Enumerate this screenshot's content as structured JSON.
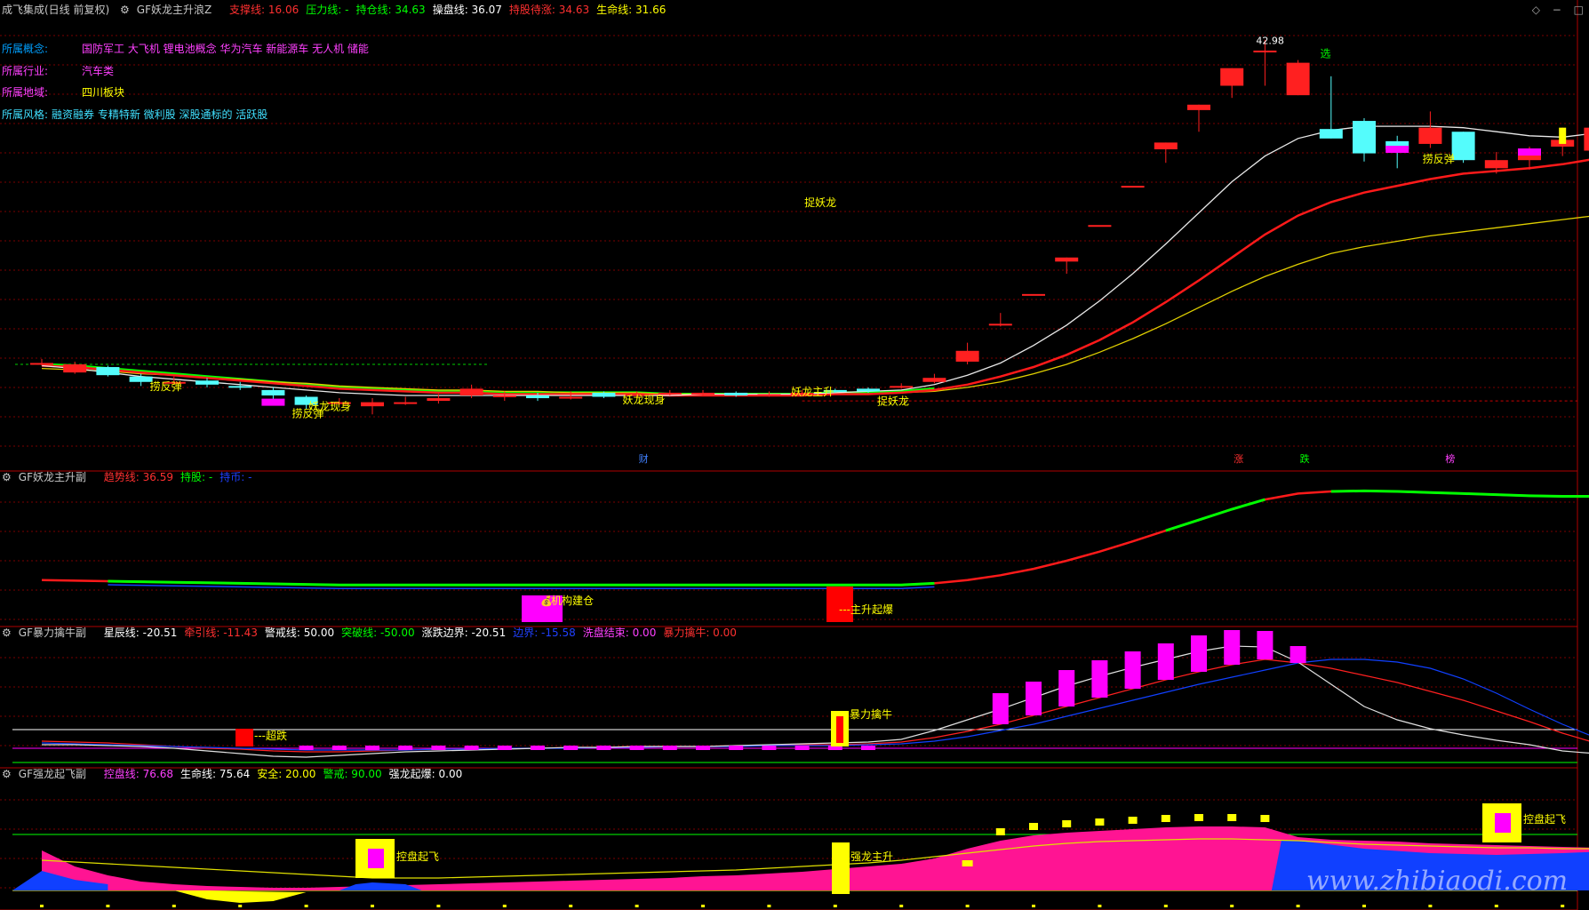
{
  "colors": {
    "bg": "#000000",
    "grid": "#7a0000",
    "red": "#ff2a2a",
    "cyan": "#54fcfc",
    "magenta": "#ff00ff",
    "yellow": "#ffff00",
    "white": "#ffffff",
    "green": "#00ff00",
    "blue": "#1040ff",
    "pink": "#ff1493",
    "text_gray": "#c8c8c8"
  },
  "window_buttons": [
    "◇",
    "−",
    "□"
  ],
  "panel1": {
    "title": "成飞集成(日线 前复权)",
    "indicator": "GF妖龙主升浪Z",
    "fields": [
      {
        "label": "支撑线:",
        "value": "16.06",
        "color": "#ff3030"
      },
      {
        "label": "压力线:",
        "value": "-",
        "color": "#00ff00"
      },
      {
        "label": "持仓线:",
        "value": "34.63",
        "color": "#00ff00"
      },
      {
        "label": "操盘线:",
        "value": "36.07",
        "color": "#ffffff"
      },
      {
        "label": "持股待涨:",
        "value": "34.63",
        "color": "#ff3030"
      },
      {
        "label": "生命线:",
        "value": "31.66",
        "color": "#ffff00"
      }
    ],
    "info": [
      {
        "label": "所属概念:",
        "value": "国防军工 大飞机 锂电池概念 华为汽车 新能源车 无人机 储能",
        "lc": "#00a0ff",
        "vc": "#ff40ff"
      },
      {
        "label": "所属行业:",
        "value": "汽车类",
        "lc": "#ff40ff",
        "vc": "#ff40ff"
      },
      {
        "label": "所属地域:",
        "value": "四川板块",
        "lc": "#ff40ff",
        "vc": "#ffff00"
      },
      {
        "label": "所属风格:",
        "value": "融资融券 专精特新 微利股 深股通标的 活跃股",
        "lc": "#40e0ff",
        "vc": "#40e0ff"
      }
    ],
    "high_label": "42.98",
    "signals": [
      {
        "text": "捞反弹",
        "color": "#ffff00"
      },
      {
        "text": "捞反弹",
        "color": "#ffff00"
      },
      {
        "text": "妖龙现身",
        "color": "#ffff00"
      },
      {
        "text": "妖龙现身",
        "color": "#ffff00"
      },
      {
        "text": "捉妖龙",
        "color": "#ffff00"
      },
      {
        "text": "妖龙主升",
        "color": "#ffff00"
      },
      {
        "text": "捉妖龙",
        "color": "#ffff00"
      },
      {
        "text": "选",
        "color": "#00ff00"
      },
      {
        "text": "捞反弹",
        "color": "#ffff00"
      },
      {
        "text": "捞反弹",
        "color": "#ffff00"
      },
      {
        "text": "妖龙现身",
        "color": "#ffff00"
      }
    ],
    "markers": [
      {
        "text": "财",
        "color": "#4080ff"
      },
      {
        "text": "涨",
        "color": "#ff3030"
      },
      {
        "text": "跌",
        "color": "#00ff00"
      },
      {
        "text": "榜",
        "color": "#ff40ff"
      }
    ]
  },
  "panel2": {
    "indicator": "GF妖龙主升副",
    "fields": [
      {
        "label": "趋势线:",
        "value": "36.59",
        "color": "#ff3030"
      },
      {
        "label": "持股:",
        "value": "-",
        "color": "#00ff00"
      },
      {
        "label": "持币:",
        "value": "-",
        "color": "#2040ff"
      }
    ],
    "signals": [
      {
        "text": "机构建仓",
        "color": "#ffff00"
      },
      {
        "text": "主升起爆",
        "color": "#ffff00"
      }
    ]
  },
  "panel3": {
    "indicator": "GF暴力擒牛副",
    "fields": [
      {
        "label": "星辰线:",
        "value": "-20.51",
        "color": "#ffffff"
      },
      {
        "label": "牵引线:",
        "value": "-11.43",
        "color": "#ff3030"
      },
      {
        "label": "警戒线:",
        "value": "50.00",
        "color": "#ffffff"
      },
      {
        "label": "突破线:",
        "value": "-50.00",
        "color": "#00ff00"
      },
      {
        "label": "涨跌边界:",
        "value": "-20.51",
        "color": "#ffffff"
      },
      {
        "label": "边界:",
        "value": "-15.58",
        "color": "#2040ff"
      },
      {
        "label": "洗盘结束:",
        "value": "0.00",
        "color": "#ff40ff"
      },
      {
        "label": "暴力擒牛:",
        "value": "0.00",
        "color": "#ff3030"
      }
    ],
    "signals": [
      {
        "text": "超跌",
        "color": "#ffff00"
      },
      {
        "text": "暴力擒牛",
        "color": "#ffff00"
      }
    ]
  },
  "panel4": {
    "indicator": "GF强龙起飞副",
    "fields": [
      {
        "label": "控盘线:",
        "value": "76.68",
        "color": "#ff40ff"
      },
      {
        "label": "生命线:",
        "value": "75.64",
        "color": "#ffffff"
      },
      {
        "label": "安全:",
        "value": "20.00",
        "color": "#ffff00"
      },
      {
        "label": "警戒:",
        "value": "90.00",
        "color": "#00ff00"
      },
      {
        "label": "强龙起爆:",
        "value": "0.00",
        "color": "#ffffff"
      }
    ],
    "signals": [
      {
        "text": "控盘起飞",
        "color": "#ffff00"
      },
      {
        "text": "强龙主升",
        "color": "#ffff00"
      },
      {
        "text": "控盘起飞",
        "color": "#ffff00"
      }
    ]
  },
  "watermark": "www.zhibiaodi.com",
  "chart_data": {
    "type": "candlestick",
    "ylim": [
      12,
      44
    ],
    "candles": [
      [
        18.9,
        19.0,
        19.3,
        18.8
      ],
      [
        18.3,
        18.9,
        19.1,
        18.2
      ],
      [
        18.7,
        18.1,
        18.8,
        18.0
      ],
      [
        18.0,
        17.6,
        18.2,
        17.3
      ],
      [
        17.6,
        17.6,
        18.0,
        17.4
      ],
      [
        17.7,
        17.4,
        17.9,
        17.2
      ],
      [
        17.3,
        17.2,
        17.6,
        17.0
      ],
      [
        17.0,
        16.6,
        17.2,
        16.3
      ],
      [
        16.5,
        15.9,
        16.6,
        15.6
      ],
      [
        16.1,
        16.1,
        16.4,
        15.9
      ],
      [
        15.8,
        16.1,
        16.4,
        15.2
      ],
      [
        16.1,
        16.1,
        16.5,
        15.9
      ],
      [
        16.2,
        16.4,
        16.7,
        16.0
      ],
      [
        16.6,
        17.1,
        17.4,
        16.4
      ],
      [
        16.6,
        16.6,
        16.9,
        16.2
      ],
      [
        16.6,
        16.4,
        16.8,
        16.2
      ],
      [
        16.5,
        16.5,
        16.9,
        16.3
      ],
      [
        16.8,
        16.5,
        16.9,
        16.4
      ],
      [
        16.6,
        16.7,
        16.9,
        16.4
      ],
      [
        16.7,
        16.8,
        17.0,
        16.6
      ],
      [
        16.8,
        16.8,
        17.0,
        16.6
      ],
      [
        16.8,
        16.6,
        16.9,
        16.5
      ],
      [
        16.7,
        16.7,
        16.9,
        16.5
      ],
      [
        16.8,
        16.8,
        17.0,
        16.7
      ],
      [
        17.0,
        16.9,
        17.1,
        16.8
      ],
      [
        17.1,
        16.9,
        17.2,
        16.8
      ],
      [
        17.2,
        17.3,
        17.5,
        17.1
      ],
      [
        17.6,
        17.9,
        18.2,
        17.5
      ],
      [
        19.1,
        19.9,
        20.5,
        18.9
      ],
      [
        21.9,
        21.9,
        22.7,
        21.7
      ],
      [
        24.1,
        24.1,
        24.1,
        24.1
      ],
      [
        26.5,
        26.8,
        26.8,
        25.6
      ],
      [
        29.2,
        29.2,
        29.2,
        29.2
      ],
      [
        32.1,
        32.1,
        32.1,
        32.1
      ],
      [
        34.8,
        35.3,
        35.3,
        33.8
      ],
      [
        37.7,
        38.1,
        38.1,
        36.1
      ],
      [
        39.5,
        40.8,
        40.8,
        38.6
      ],
      [
        42.1,
        42.1,
        42.9,
        39.5
      ],
      [
        38.8,
        41.2,
        41.4,
        38.8
      ],
      [
        36.3,
        35.6,
        40.2,
        35.6
      ],
      [
        36.9,
        34.5,
        37.1,
        33.9
      ],
      [
        35.4,
        34.8,
        35.8,
        33.4
      ],
      [
        35.2,
        36.4,
        37.6,
        34.9
      ],
      [
        36.1,
        34.0,
        36.1,
        33.8
      ],
      [
        33.4,
        34.0,
        34.6,
        33.0
      ],
      [
        34.0,
        34.6,
        35.0,
        33.3
      ],
      [
        35.0,
        35.5,
        36.4,
        34.3
      ],
      [
        34.7,
        36.4,
        37.5,
        34.5
      ],
      [
        36.7,
        39.0,
        39.7,
        34.7
      ],
      [
        39.4,
        38.2,
        40.6,
        38.1
      ],
      [
        37.7,
        37.0,
        37.8,
        36.9
      ]
    ],
    "ma_white": [
      18.8,
      18.6,
      18.3,
      18.0,
      17.8,
      17.6,
      17.4,
      17.2,
      17.0,
      16.8,
      16.7,
      16.6,
      16.6,
      16.6,
      16.6,
      16.6,
      16.6,
      16.6,
      16.6,
      16.6,
      16.7,
      16.7,
      16.7,
      16.7,
      16.8,
      16.9,
      17.0,
      17.4,
      18.1,
      19.0,
      20.3,
      21.8,
      23.6,
      25.6,
      27.8,
      30.1,
      32.4,
      34.3,
      35.6,
      36.2,
      36.5,
      36.5,
      36.5,
      36.4,
      36.1,
      35.8,
      35.7,
      36.0,
      36.6,
      37.1,
      37.3
    ],
    "ma_red": [
      18.8,
      18.7,
      18.5,
      18.3,
      18.1,
      17.9,
      17.7,
      17.5,
      17.3,
      17.1,
      17.0,
      16.9,
      16.8,
      16.8,
      16.7,
      16.7,
      16.7,
      16.7,
      16.7,
      16.6,
      16.6,
      16.6,
      16.6,
      16.6,
      16.7,
      16.7,
      16.8,
      17.0,
      17.4,
      18.0,
      18.7,
      19.6,
      20.7,
      22.0,
      23.5,
      25.1,
      26.8,
      28.5,
      29.9,
      30.9,
      31.6,
      32.1,
      32.6,
      33.0,
      33.2,
      33.4,
      33.7,
      34.1,
      34.6,
      35.0,
      35.3
    ],
    "ma_yellow": [
      18.6,
      18.5,
      18.4,
      18.2,
      18.1,
      17.9,
      17.8,
      17.6,
      17.5,
      17.3,
      17.2,
      17.1,
      17.0,
      17.0,
      16.9,
      16.9,
      16.8,
      16.8,
      16.8,
      16.7,
      16.7,
      16.7,
      16.7,
      16.7,
      16.7,
      16.7,
      16.8,
      16.9,
      17.2,
      17.6,
      18.2,
      18.9,
      19.8,
      20.8,
      21.9,
      23.1,
      24.3,
      25.4,
      26.3,
      27.1,
      27.6,
      28.0,
      28.4,
      28.7,
      29.0,
      29.3,
      29.6,
      29.9,
      30.3,
      30.8,
      31.4
    ],
    "trend": [
      18.8,
      18.7,
      18.6,
      18.5,
      18.4,
      18.3,
      18.2,
      18.1,
      18.0,
      17.9,
      17.9,
      17.9,
      17.9,
      17.9,
      17.9,
      17.9,
      17.9,
      17.9,
      17.9,
      17.9,
      17.9,
      17.9,
      17.9,
      17.9,
      17.9,
      17.9,
      17.9,
      18.2,
      18.8,
      19.7,
      20.9,
      22.4,
      24.1,
      26.0,
      28.0,
      30.0,
      32.0,
      33.8,
      34.9,
      35.3,
      35.4,
      35.3,
      35.1,
      34.9,
      34.7,
      34.5,
      34.4,
      34.4,
      34.5,
      34.6,
      34.6
    ]
  }
}
